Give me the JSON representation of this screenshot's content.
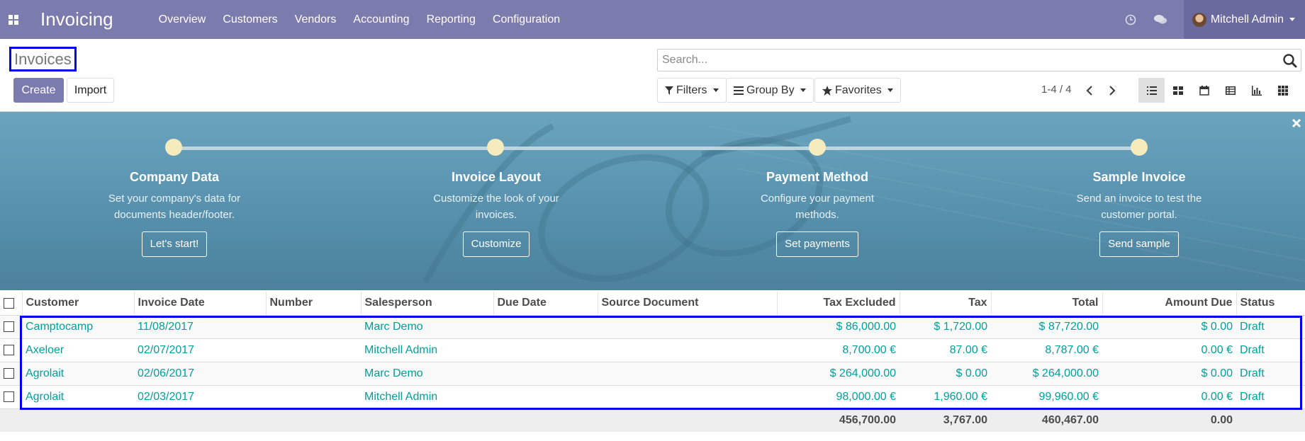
{
  "navbar": {
    "app_name": "Invoicing",
    "menu": [
      "Overview",
      "Customers",
      "Vendors",
      "Accounting",
      "Reporting",
      "Configuration"
    ],
    "user_name": "Mitchell Admin",
    "icons": [
      "apps-grid-icon",
      "clock-icon",
      "chat-icon"
    ],
    "background_color": "#7c7bad"
  },
  "control_panel": {
    "title": "Invoices",
    "create_label": "Create",
    "import_label": "Import",
    "search_placeholder": "Search...",
    "filters_label": "Filters",
    "group_by_label": "Group By",
    "favorites_label": "Favorites",
    "pager_value": "1-4 / 4",
    "views": [
      "list",
      "kanban",
      "calendar",
      "pivot",
      "graph",
      "grid"
    ],
    "active_view": "list"
  },
  "onboarding": {
    "steps": [
      {
        "title": "Company Data",
        "text": "Set your company's data for documents header/footer.",
        "button": "Let's start!"
      },
      {
        "title": "Invoice Layout",
        "text": "Customize the look of your invoices.",
        "button": "Customize"
      },
      {
        "title": "Payment Method",
        "text": "Configure your payment methods.",
        "button": "Set payments"
      },
      {
        "title": "Sample Invoice",
        "text": "Send an invoice to test the customer portal.",
        "button": "Send sample"
      }
    ]
  },
  "table": {
    "columns": [
      "Customer",
      "Invoice Date",
      "Number",
      "Salesperson",
      "Due Date",
      "Source Document",
      "Tax Excluded",
      "Tax",
      "Total",
      "Amount Due",
      "Status"
    ],
    "rows": [
      {
        "customer": "Camptocamp",
        "invoice_date": "11/08/2017",
        "number": "",
        "salesperson": "Marc Demo",
        "due_date": "",
        "source": "",
        "tax_excluded": "$ 86,000.00",
        "tax": "$ 1,720.00",
        "total": "$ 87,720.00",
        "amount_due": "$ 0.00",
        "status": "Draft"
      },
      {
        "customer": "Axeloer",
        "invoice_date": "02/07/2017",
        "number": "",
        "salesperson": "Mitchell Admin",
        "due_date": "",
        "source": "",
        "tax_excluded": "8,700.00 €",
        "tax": "87.00 €",
        "total": "8,787.00 €",
        "amount_due": "0.00 €",
        "status": "Draft"
      },
      {
        "customer": "Agrolait",
        "invoice_date": "02/06/2017",
        "number": "",
        "salesperson": "Marc Demo",
        "due_date": "",
        "source": "",
        "tax_excluded": "$ 264,000.00",
        "tax": "$ 0.00",
        "total": "$ 264,000.00",
        "amount_due": "$ 0.00",
        "status": "Draft"
      },
      {
        "customer": "Agrolait",
        "invoice_date": "02/03/2017",
        "number": "",
        "salesperson": "Mitchell Admin",
        "due_date": "",
        "source": "",
        "tax_excluded": "98,000.00 €",
        "tax": "1,960.00 €",
        "total": "99,960.00 €",
        "amount_due": "0.00 €",
        "status": "Draft"
      }
    ],
    "totals": {
      "tax_excluded": "456,700.00",
      "tax": "3,767.00",
      "total": "460,467.00",
      "amount_due": "0.00"
    }
  }
}
